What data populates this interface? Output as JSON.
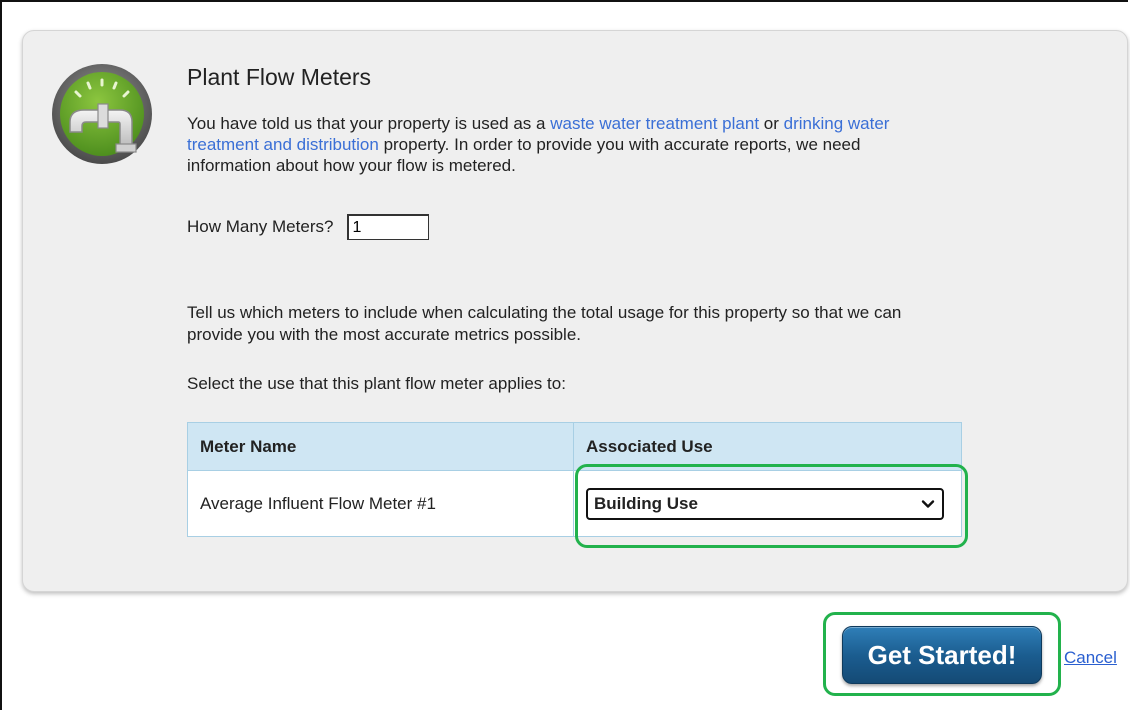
{
  "panel": {
    "icon": "pipe-gauge-icon",
    "title": "Plant Flow Meters",
    "intro": {
      "part1": "You have told us that your property is used as a ",
      "link1": "waste water treatment plant",
      "part2": " or ",
      "link2": "drinking water treatment and distribution",
      "part3": " property. In order to provide you with accurate reports, we need information about how your flow is metered."
    },
    "meters": {
      "label": "How Many Meters?",
      "value": "1"
    },
    "tell_text": "Tell us which meters to include when calculating the total usage for this property so that we can provide you with the most accurate metrics possible.",
    "select_label": "Select the use that this plant flow meter applies to:",
    "table": {
      "headers": [
        "Meter Name",
        "Associated Use"
      ],
      "rows": [
        {
          "meter_name": "Average Influent Flow Meter #1",
          "associated_use": "Building Use"
        }
      ]
    }
  },
  "actions": {
    "start_label": "Get Started!",
    "cancel_label": "Cancel"
  },
  "colors": {
    "accent_highlight": "#22b24c",
    "link": "#3a6fd6",
    "button": "#1b5d90",
    "table_header": "#cfe6f3"
  }
}
